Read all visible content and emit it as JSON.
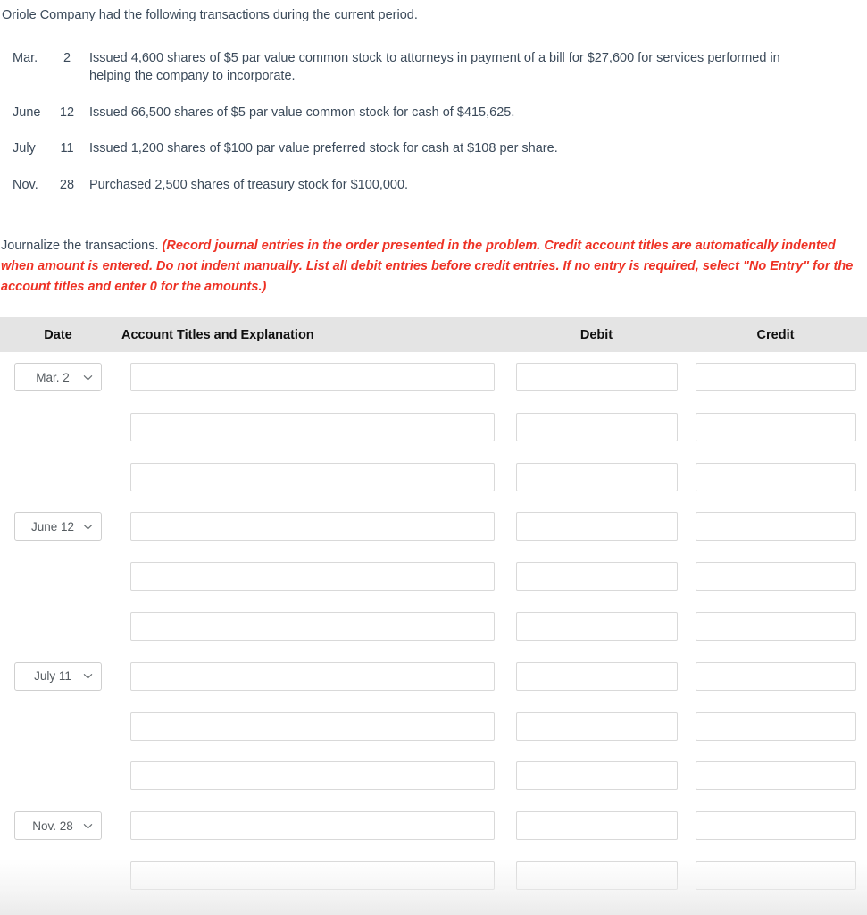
{
  "intro": {
    "text": "Oriole Company had the following transactions during the current period."
  },
  "transactions": [
    {
      "month": "Mar.",
      "day": "2",
      "description": "Issued 4,600 shares of $5 par value common stock to attorneys in payment of a bill for $27,600 for services performed in helping the company to incorporate."
    },
    {
      "month": "June",
      "day": "12",
      "description": "Issued 66,500 shares of $5 par value common stock for cash of $415,625."
    },
    {
      "month": "July",
      "day": "11",
      "description": "Issued 1,200 shares of $100 par value preferred stock for cash at $108 per share."
    },
    {
      "month": "Nov.",
      "day": "28",
      "description": "Purchased 2,500 shares of treasury stock for $100,000."
    }
  ],
  "prompt": {
    "lead": "Journalize the transactions. ",
    "instruction": "(Record journal entries in the order presented in the problem. Credit account titles are automatically indented when amount is entered. Do not indent manually. List all debit entries before credit entries. If no entry is required, select \"No Entry\" for the account titles and enter 0 for the amounts.)",
    "instruction_color": "#ee3124"
  },
  "journal": {
    "headers": {
      "date": "Date",
      "account": "Account Titles and Explanation",
      "debit": "Debit",
      "credit": "Credit"
    },
    "header_bg": "#e4e4e4",
    "rows": [
      {
        "date": "Mar. 2",
        "has_date": true,
        "account": "",
        "debit": "",
        "credit": ""
      },
      {
        "date": "",
        "has_date": false,
        "account": "",
        "debit": "",
        "credit": ""
      },
      {
        "date": "",
        "has_date": false,
        "account": "",
        "debit": "",
        "credit": ""
      },
      {
        "date": "June 12",
        "has_date": true,
        "account": "",
        "debit": "",
        "credit": ""
      },
      {
        "date": "",
        "has_date": false,
        "account": "",
        "debit": "",
        "credit": ""
      },
      {
        "date": "",
        "has_date": false,
        "account": "",
        "debit": "",
        "credit": ""
      },
      {
        "date": "July 11",
        "has_date": true,
        "account": "",
        "debit": "",
        "credit": ""
      },
      {
        "date": "",
        "has_date": false,
        "account": "",
        "debit": "",
        "credit": ""
      },
      {
        "date": "",
        "has_date": false,
        "account": "",
        "debit": "",
        "credit": ""
      },
      {
        "date": "Nov. 28",
        "has_date": true,
        "account": "",
        "debit": "",
        "credit": ""
      },
      {
        "date": "",
        "has_date": false,
        "account": "",
        "debit": "",
        "credit": ""
      }
    ],
    "date_options": [
      "Mar. 2",
      "June 12",
      "July 11",
      "Nov. 28"
    ],
    "dropdown_icon": "chevron-down-icon"
  }
}
